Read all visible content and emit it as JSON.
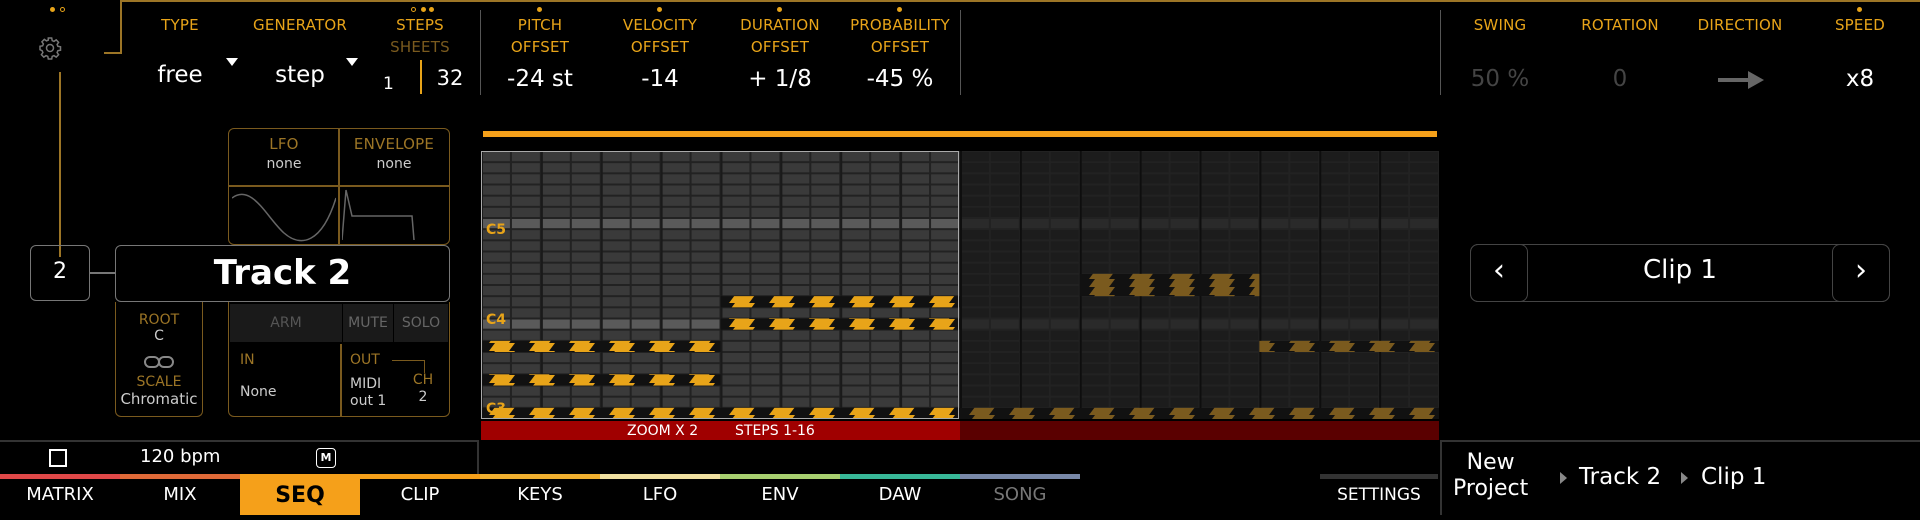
{
  "header": {
    "type": {
      "label": "TYPE",
      "value": "free"
    },
    "generator": {
      "label": "GENERATOR",
      "value": "step"
    },
    "steps": {
      "label": "STEPS",
      "sublabel": "SHEETS",
      "sheets": "1",
      "steps": "32"
    },
    "pitch_offset": {
      "label1": "PITCH",
      "label2": "OFFSET",
      "value": "-24 st"
    },
    "velocity_offset": {
      "label1": "VELOCITY",
      "label2": "OFFSET",
      "value": "-14"
    },
    "duration_offset": {
      "label1": "DURATION",
      "label2": "OFFSET",
      "value": "+ 1/8"
    },
    "probability_offset": {
      "label1": "PROBABILITY",
      "label2": "OFFSET",
      "value": "-45 %"
    },
    "swing": {
      "label": "SWING",
      "value": "50 %"
    },
    "rotation": {
      "label": "ROTATION",
      "value": "0"
    },
    "direction": {
      "label": "DIRECTION",
      "icon": "arrow-right-icon"
    },
    "speed": {
      "label": "SPEED",
      "value": "x8"
    }
  },
  "track": {
    "number": "2",
    "name": "Track 2",
    "lfo": {
      "label": "LFO",
      "value": "none"
    },
    "envelope": {
      "label": "ENVELOPE",
      "value": "none"
    },
    "root": {
      "label": "ROOT",
      "value": "C"
    },
    "scale": {
      "label": "SCALE",
      "value": "Chromatic"
    },
    "arm": "ARM",
    "mute": "MUTE",
    "solo": "SOLO",
    "in": {
      "label": "IN",
      "value": "None"
    },
    "out": {
      "label": "OUT",
      "value1": "MIDI",
      "value2": "out 1"
    },
    "ch": {
      "label": "CH",
      "value": "2"
    }
  },
  "grid": {
    "notes": [
      "C5",
      "C4",
      "C3"
    ],
    "zoom": "ZOOM X 2",
    "steps_range": "STEPS 1-16"
  },
  "clip": {
    "name": "Clip 1",
    "prev": "‹",
    "next": "›"
  },
  "transport": {
    "bpm": "120 bpm",
    "m_label": "M"
  },
  "tabs": [
    {
      "label": "MATRIX",
      "color": "#e04848",
      "active": false
    },
    {
      "label": "MIX",
      "color": "#e06a38",
      "active": false
    },
    {
      "label": "SEQ",
      "color": "#f5a01a",
      "active": true
    },
    {
      "label": "CLIP",
      "color": "#f5a01a",
      "active": false
    },
    {
      "label": "KEYS",
      "color": "#f0b030",
      "active": false
    },
    {
      "label": "LFO",
      "color": "#f0e0a0",
      "active": false
    },
    {
      "label": "ENV",
      "color": "#a8d070",
      "active": false
    },
    {
      "label": "DAW",
      "color": "#38b898",
      "active": false
    },
    {
      "label": "SONG",
      "color": "#7888a8",
      "active": false
    }
  ],
  "settings": "SETTINGS",
  "breadcrumb": {
    "project1": "New",
    "project2": "Project",
    "track": "Track 2",
    "clip": "Clip 1"
  },
  "colors": {
    "accent": "#e8a419",
    "active_tab": "#f5a01a",
    "zoom_bar": "#a00000"
  }
}
